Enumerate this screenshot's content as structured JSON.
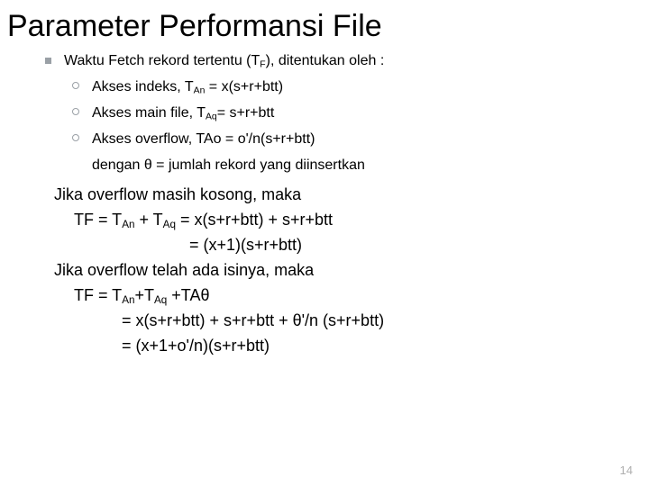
{
  "title": "Parameter Performansi File",
  "b1": {
    "main_pre": "Waktu Fetch rekord tertentu (T",
    "main_sub": "F",
    "main_post": "), ditentukan oleh :",
    "l1_pre": "Akses indeks, T",
    "l1_sub": "An",
    "l1_post": " = x(s+r+btt)",
    "l2_pre": "Akses main file, T",
    "l2_sub": "Aq",
    "l2_post": "= s+r+btt",
    "l3_pre": "Akses overflow, TAo = o'/n(s+r+btt)",
    "l4": "dengan θ = jumlah rekord yang diinsertkan"
  },
  "b2": {
    "h1": "Jika overflow masih kosong, maka",
    "e1a_pre": "TF = T",
    "e1a_s1": "An",
    "e1a_mid": " + T",
    "e1a_s2": "Aq",
    "e1a_post": " = x(s+r+btt) + s+r+btt",
    "e1b": "= (x+1)(s+r+btt)",
    "h2": "Jika overflow telah ada isinya, maka",
    "e2a_pre": "TF = T",
    "e2a_s1": "An",
    "e2a_mid": "+T",
    "e2a_s2": "Aq",
    "e2a_post": " +TAθ",
    "e2b": "= x(s+r+btt) + s+r+btt + θ'/n (s+r+btt)",
    "e2c": "= (x+1+o'/n)(s+r+btt)"
  },
  "pagenum": "14"
}
